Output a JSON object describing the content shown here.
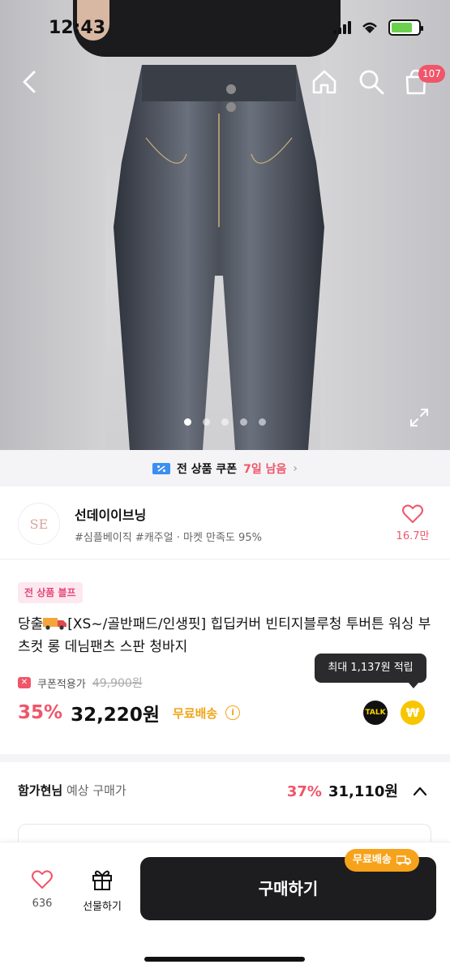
{
  "status": {
    "time": "12:43"
  },
  "nav": {
    "cart_badge": "107"
  },
  "carousel": {
    "slides": 5,
    "active": 0
  },
  "coupon_bar": {
    "text": "전 상품 쿠폰",
    "days": "7일 남음",
    "chevron": "›"
  },
  "store": {
    "name": "선데이이브닝",
    "tags": "#심플베이직 #캐주얼 · 마켓 만족도 95%",
    "likes": "16.7만",
    "logo_text": "SE"
  },
  "product": {
    "badge": "전 상품 블프",
    "title_prefix": "당출",
    "title": "[XS~/골반패드/인생핏] 힙딥커버 빈티지블루청 투버튼 워싱 부츠컷 롱 데님팬츠 스판 청바지",
    "tooltip": "최대 1,137원 적립",
    "coupon_label": "쿠폰적용가",
    "original_price": "49,900원",
    "discount": "35%",
    "price": "32,220원",
    "free_shipping": "무료배송",
    "talk": "TALK",
    "won": "₩"
  },
  "expected": {
    "user": "함가현님",
    "label": "예상 구매가",
    "discount": "37%",
    "price": "31,110원"
  },
  "bottom": {
    "wish_count": "636",
    "gift_label": "선물하기",
    "buy_label": "구매하기",
    "free_pill": "무료배송"
  },
  "colors": {
    "accent": "#f0556a",
    "orange": "#f7a21b",
    "dark": "#1d1d1f"
  }
}
